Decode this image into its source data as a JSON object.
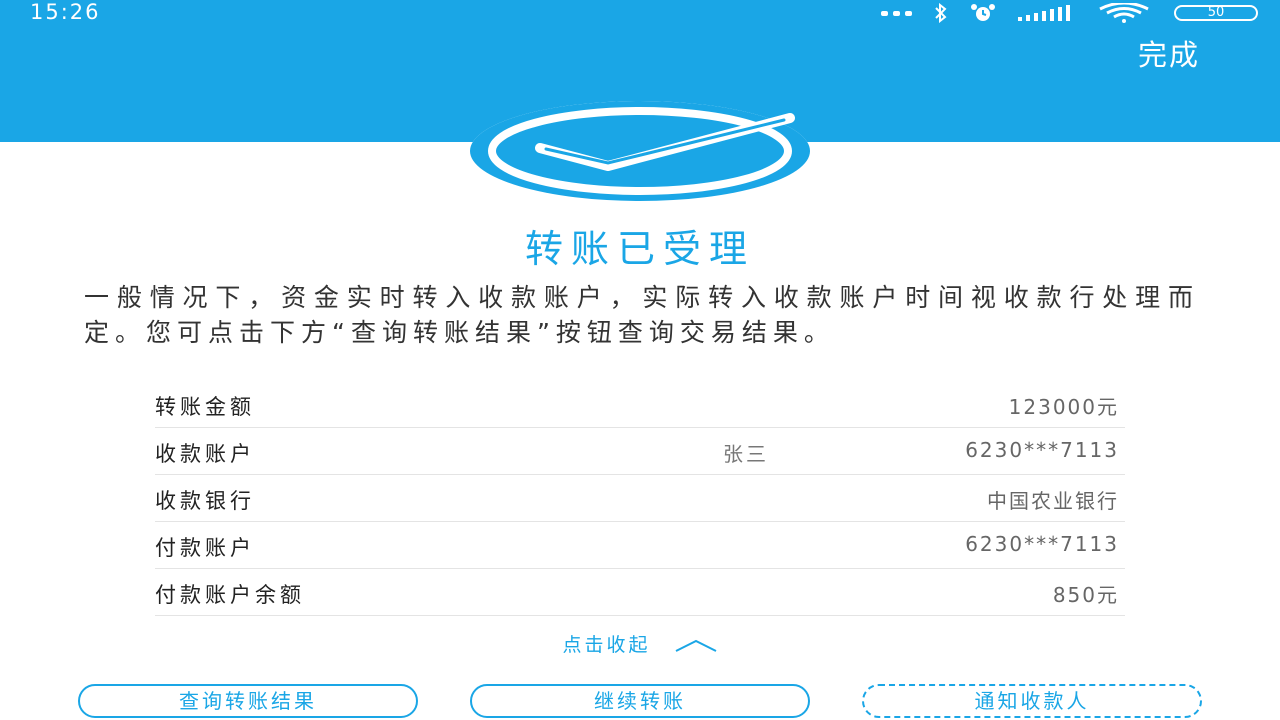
{
  "status_bar": {
    "time": "15:26",
    "battery": "50"
  },
  "header": {
    "done_label": "完成"
  },
  "result": {
    "title": "转账已受理",
    "notice": "一般情况下，资金实时转入收款账户，实际转入收款账户时间视收款行处理而定。您可点击下方“查询转账结果”按钮查询交易结果。"
  },
  "details": [
    {
      "label": "转账金额",
      "name": "",
      "value": "123000元"
    },
    {
      "label": "收款账户",
      "name": "张三",
      "value": "6230***7113"
    },
    {
      "label": "收款银行",
      "name": "",
      "value": "中国农业银行"
    },
    {
      "label": "付款账户",
      "name": "",
      "value": "6230***7113"
    },
    {
      "label": "付款账户余额",
      "name": "",
      "value": "850元"
    }
  ],
  "collapse_label": "点击收起",
  "actions": {
    "query_result": "查询转账结果",
    "continue_transfer": "继续转账",
    "notify_payee": "通知收款人"
  },
  "colors": {
    "brand_blue": "#1aa6e6",
    "background": "#ffffff"
  },
  "icons": [
    "bluetooth-icon",
    "alarm-icon",
    "signal-icon",
    "wifi-icon",
    "battery-icon",
    "check-icon",
    "chevron-up-icon"
  ]
}
